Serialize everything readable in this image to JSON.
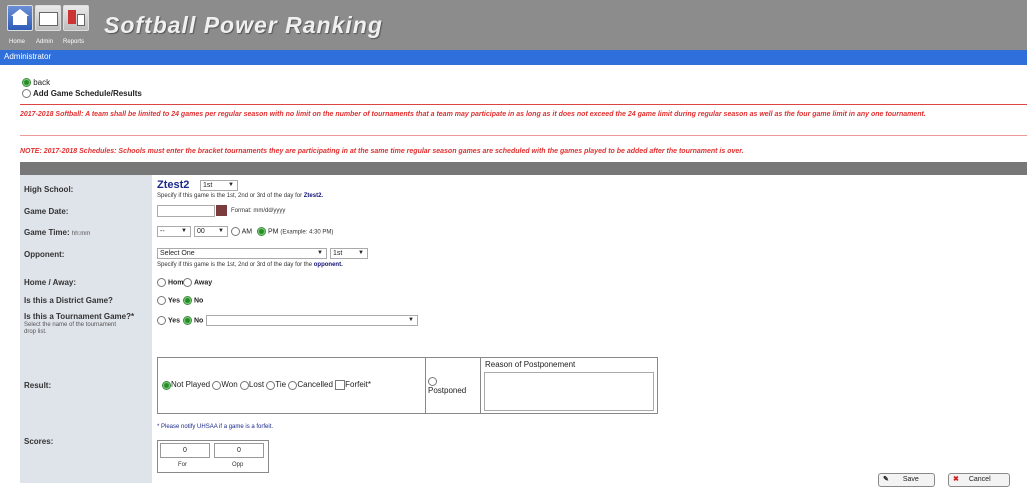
{
  "header": {
    "title": "Softball Power Ranking",
    "nav": [
      {
        "label": "Home",
        "icon": "home-icon"
      },
      {
        "label": "Admin",
        "icon": "mail-icon"
      },
      {
        "label": "Reports",
        "icon": "reports-icon"
      }
    ]
  },
  "admin_bar": {
    "label": "Administrator"
  },
  "mode_options": {
    "back": "back",
    "add": "Add Game Schedule/Results"
  },
  "notices": {
    "first": "2017-2018 Softball: A team shall be limited to 24 games per regular season with no limit on the number of tournaments that a team may participate in as long as it does not exceed the 24 game limit during regular season as well as the four game limit in any one tournament.",
    "second": "NOTE: 2017-2018 Schedules: Schools must enter the bracket tournaments they are participating in at the same time regular season games are scheduled with the games played to be added after the tournament is over."
  },
  "form": {
    "high_school": {
      "label": "High School:",
      "value": "Ztest2",
      "order": "1st",
      "hint_prefix": "Specify if this game is the 1st, 2nd or 3rd of the day for",
      "hint_target": "Ztest2."
    },
    "game_date": {
      "label": "Game Date:",
      "format_hint": "Format: mm/dd/yyyy"
    },
    "game_time": {
      "label": "Game Time:",
      "label_suffix": "hh:mm",
      "hour": "--",
      "minute": "00",
      "am_label": "AM",
      "pm_label": "PM",
      "example": "(Example: 4:30 PM)"
    },
    "opponent": {
      "label": "Opponent:",
      "placeholder": "Select One",
      "order": "1st",
      "hint_prefix": "Specify if this game is the 1st, 2nd or 3rd of the day for the",
      "hint_target": "opponent."
    },
    "home_away": {
      "label": "Home / Away:",
      "options": [
        "Home",
        "Away"
      ]
    },
    "district": {
      "label": "Is this a District Game?",
      "options": [
        "Yes",
        "No"
      ],
      "selected": "No"
    },
    "tournament": {
      "label": "Is this a Tournament Game?*",
      "sub": "Select the name of the tournament drop list.",
      "options": [
        "Yes",
        "No"
      ],
      "selected": "No"
    },
    "result": {
      "label": "Result:",
      "options": [
        "Not Played",
        "Won",
        "Lost",
        "Tie",
        "Cancelled",
        "Forfeit*",
        "Postponed"
      ],
      "selected": "Not Played",
      "postponed": "Postponed",
      "reason_header": "Reason of Postponement",
      "forfeit_note": "* Please notify UHSAA if a game is a forfeit."
    },
    "scores": {
      "label": "Scores:",
      "for_value": "0",
      "opp_value": "0",
      "for_label": "For",
      "opp_label": "Opp"
    }
  },
  "buttons": {
    "save": "Save",
    "cancel": "Cancel"
  },
  "colors": {
    "header_bg": "#8c8c8c",
    "admin_bar": "#2f6fdc",
    "notice_red": "#e03030",
    "label_bg": "#dfe3ea"
  }
}
